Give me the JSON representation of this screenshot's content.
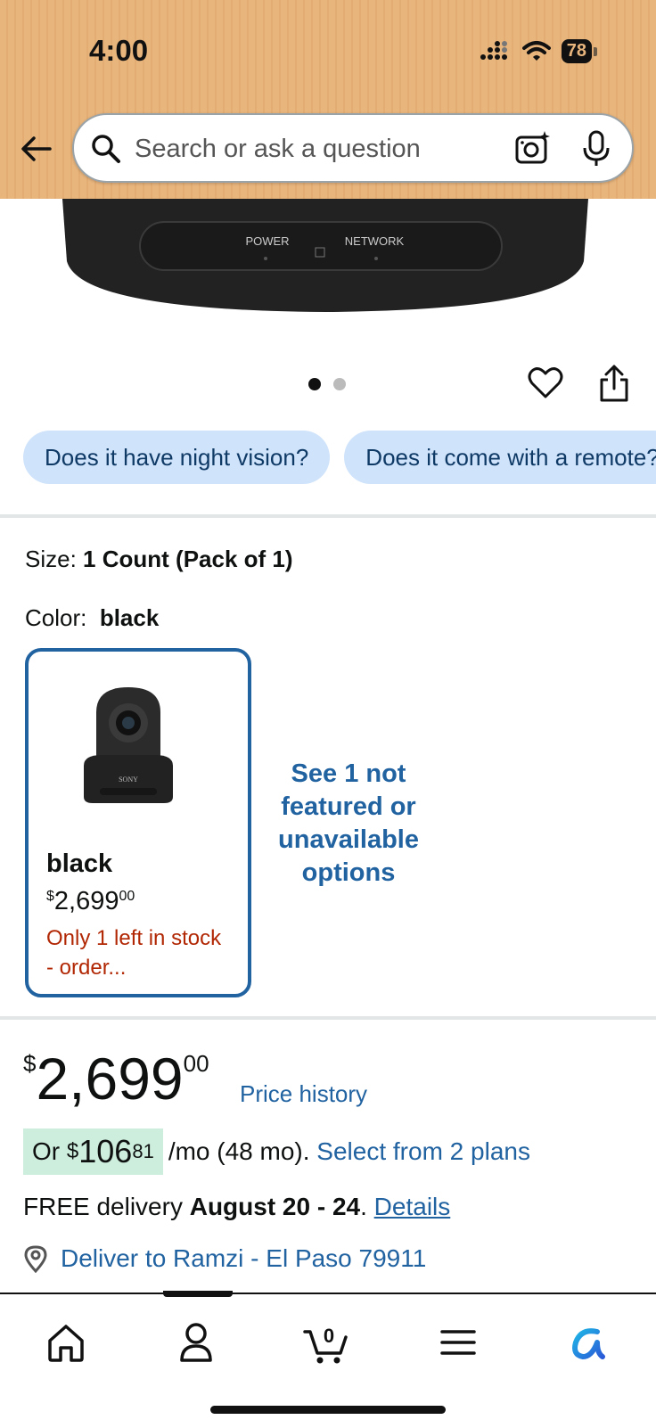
{
  "status_bar": {
    "time": "4:00",
    "battery": "78"
  },
  "search": {
    "placeholder": "Search or ask a question"
  },
  "product_image": {
    "labels": [
      "POWER",
      "NETWORK"
    ]
  },
  "carousel": {
    "total": 2,
    "active": 1
  },
  "questions": [
    "Does it have night vision?",
    "Does it come with a remote?"
  ],
  "size": {
    "label": "Size:",
    "value": "1 Count (Pack of 1)"
  },
  "color": {
    "label": "Color:",
    "value": "black"
  },
  "swatch": {
    "name": "black",
    "price_symbol": "$",
    "price_whole": "2,699",
    "price_cents": "00",
    "stock": "Only 1 left in stock - order..."
  },
  "see_options": "See 1 not featured or unavailable options",
  "price": {
    "symbol": "$",
    "whole": "2,699",
    "cents": "00",
    "history": "Price history"
  },
  "monthly": {
    "prefix": "Or",
    "symbol": "$",
    "whole": "106",
    "cents": "81",
    "terms": "/mo (48 mo).",
    "plans": "Select from 2 plans"
  },
  "delivery": {
    "prefix": "FREE delivery",
    "dates": "August 20 - 24",
    "details": "Details"
  },
  "deliver_to": "Deliver to Ramzi - El Paso 79911",
  "nav": {
    "cart_count": "0",
    "items": [
      "home",
      "account",
      "cart",
      "menu",
      "rufus"
    ]
  },
  "colors": {
    "link": "#2162a1",
    "stock_red": "#b12704",
    "header": "#e8b57d",
    "chip": "#cfe3fb",
    "badge": "#cdeedd"
  }
}
